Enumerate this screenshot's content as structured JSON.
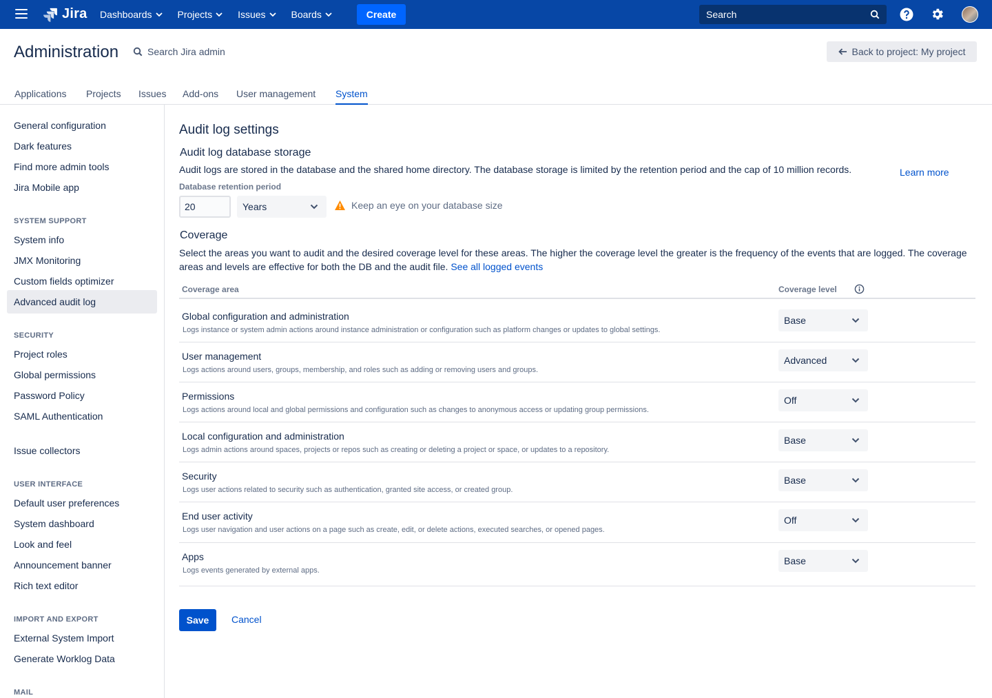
{
  "topnav": {
    "logo": "Jira",
    "items": [
      {
        "label": "Dashboards"
      },
      {
        "label": "Projects"
      },
      {
        "label": "Issues"
      },
      {
        "label": "Boards"
      }
    ],
    "create_label": "Create",
    "search_placeholder": "Search",
    "icons": [
      "menu-icon",
      "jira-logo-icon",
      "search-icon",
      "help-icon",
      "gear-icon",
      "avatar"
    ],
    "colors": {
      "bar": "#0747a6",
      "create": "#0065ff",
      "search": "#08336f"
    }
  },
  "header": {
    "title": "Administration",
    "search_label": "Search Jira admin",
    "back_label": "Back to project: My project"
  },
  "tabs": [
    {
      "label": "Applications"
    },
    {
      "label": "Projects"
    },
    {
      "label": "Issues"
    },
    {
      "label": "Add-ons"
    },
    {
      "label": "User management"
    },
    {
      "label": "System",
      "active": true
    }
  ],
  "sidebar": {
    "group0": [
      "General configuration",
      "Dark features",
      "Find more admin tools",
      "Jira Mobile app"
    ],
    "system_support": {
      "heading": "SYSTEM SUPPORT",
      "items": [
        "System info",
        "JMX Monitoring",
        "Custom fields optimizer",
        "Advanced audit log"
      ]
    },
    "security": {
      "heading": "SECURITY",
      "items": [
        "Project roles",
        "Global permissions",
        "Password Policy",
        "SAML Authentication"
      ]
    },
    "issue_collectors": "Issue collectors",
    "user_interface": {
      "heading": "USER INTERFACE",
      "items": [
        "Default user preferences",
        "System dashboard",
        "Look and feel",
        "Announcement banner",
        "Rich text editor"
      ]
    },
    "import_export": {
      "heading": "IMPORT AND EXPORT",
      "items": [
        "External System Import",
        "Generate Worklog Data"
      ]
    },
    "mail": {
      "heading": "MAIL"
    },
    "active_item": "Advanced audit log"
  },
  "main": {
    "title": "Audit log settings",
    "storage_heading": "Audit log database storage",
    "storage_desc": "Audit logs are stored in the database and the shared home directory. The database storage is limited by the retention period and the cap of 10 million records.",
    "learn_more": "Learn more",
    "retention_label": "Database retention period",
    "retention_value": "20",
    "retention_unit": "Years",
    "warning": "Keep an eye on your database size",
    "coverage_heading": "Coverage",
    "coverage_desc": "Select the areas you want to audit and the desired coverage level for these areas. The higher the coverage level the greater is the frequency of the events that are logged. The coverage areas and levels are effective for both the DB and the audit file.",
    "see_all": "See all logged events",
    "col_area": "Coverage area",
    "col_level": "Coverage level",
    "rows": [
      {
        "title": "Global configuration and administration",
        "desc": "Logs instance or system admin actions around instance administration or configuration such as platform changes or updates to global settings.",
        "level": "Base"
      },
      {
        "title": "User management",
        "desc": "Logs actions around users, groups, membership, and roles such as adding or removing users and groups.",
        "level": "Advanced"
      },
      {
        "title": "Permissions",
        "desc": "Logs actions around local and global permissions and configuration such as changes to anonymous access or updating group permissions.",
        "level": "Off"
      },
      {
        "title": "Local configuration and administration",
        "desc": "Logs admin actions around spaces, projects or repos such as creating or deleting a project or space, or updates to a repository.",
        "level": "Base"
      },
      {
        "title": "Security",
        "desc": "Logs user actions related to security such as authentication, granted site access, or created group.",
        "level": "Base"
      },
      {
        "title": "End user activity",
        "desc": "Logs user navigation and user actions on a page such as create, edit, or delete actions, executed searches, or opened pages.",
        "level": "Off"
      },
      {
        "title": "Apps",
        "desc": "Logs events generated by external apps.",
        "level": "Base"
      }
    ],
    "save_label": "Save",
    "cancel_label": "Cancel"
  }
}
